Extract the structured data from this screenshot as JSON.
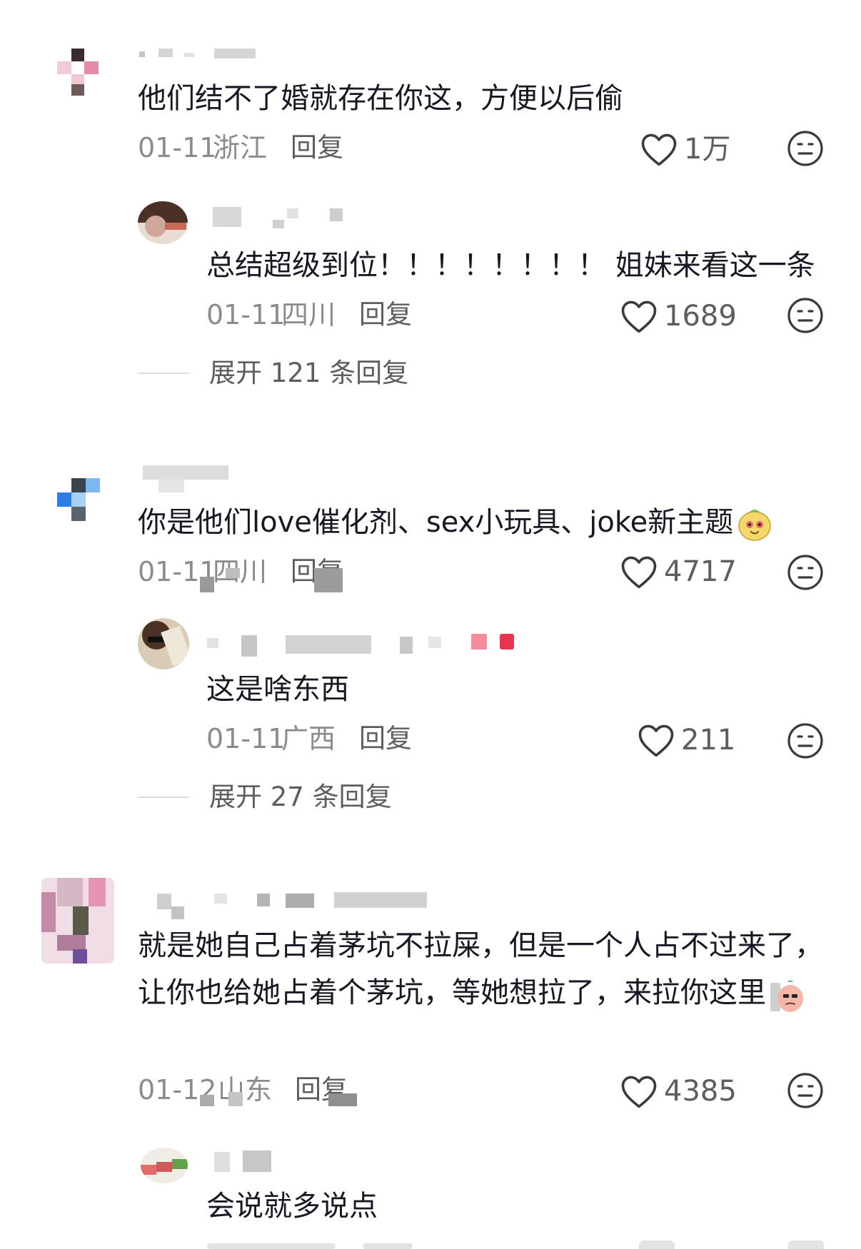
{
  "comments": [
    {
      "text": "他们结不了婚就存在你这，方便以后偷",
      "date": "01-11",
      "location": "浙江",
      "reply_label": "回复",
      "likes": "1万",
      "replies": [
        {
          "text": "总结超级到位！！！！！！！！ 姐妹来看这一条",
          "date": "01-11",
          "location": "四川",
          "reply_label": "回复",
          "likes": "1689"
        }
      ],
      "expand": {
        "prefix": "展开",
        "count": "121",
        "suffix": "条回复"
      }
    },
    {
      "text": "你是他们love催化剂、sex小玩具、joke新主题",
      "date": "01-11",
      "location": "四川",
      "reply_label": "回复",
      "likes": "4717",
      "replies": [
        {
          "text": "这是啥东西",
          "date": "01-11",
          "location": "广西",
          "reply_label": "回复",
          "likes": "211"
        }
      ],
      "expand": {
        "prefix": "展开",
        "count": "27",
        "suffix": "条回复"
      }
    },
    {
      "text": "就是她自己占着茅坑不拉屎，但是一个人占不过来了，让你也给她占着个茅坑，等她想拉了，来拉你这里",
      "date": "01-12",
      "location": "山东",
      "reply_label": "回复",
      "likes": "4385",
      "replies": [
        {
          "text": "会说就多说点"
        }
      ]
    }
  ],
  "icons": {
    "like": "heart-outline-icon",
    "dislike": "meh-face-icon",
    "emoji1": "dog-face-emoji",
    "emoji2": "sly-peach-emoji"
  },
  "colors": {
    "text": "#161823",
    "meta": "#8a8b91",
    "action": "#5c5d63"
  }
}
